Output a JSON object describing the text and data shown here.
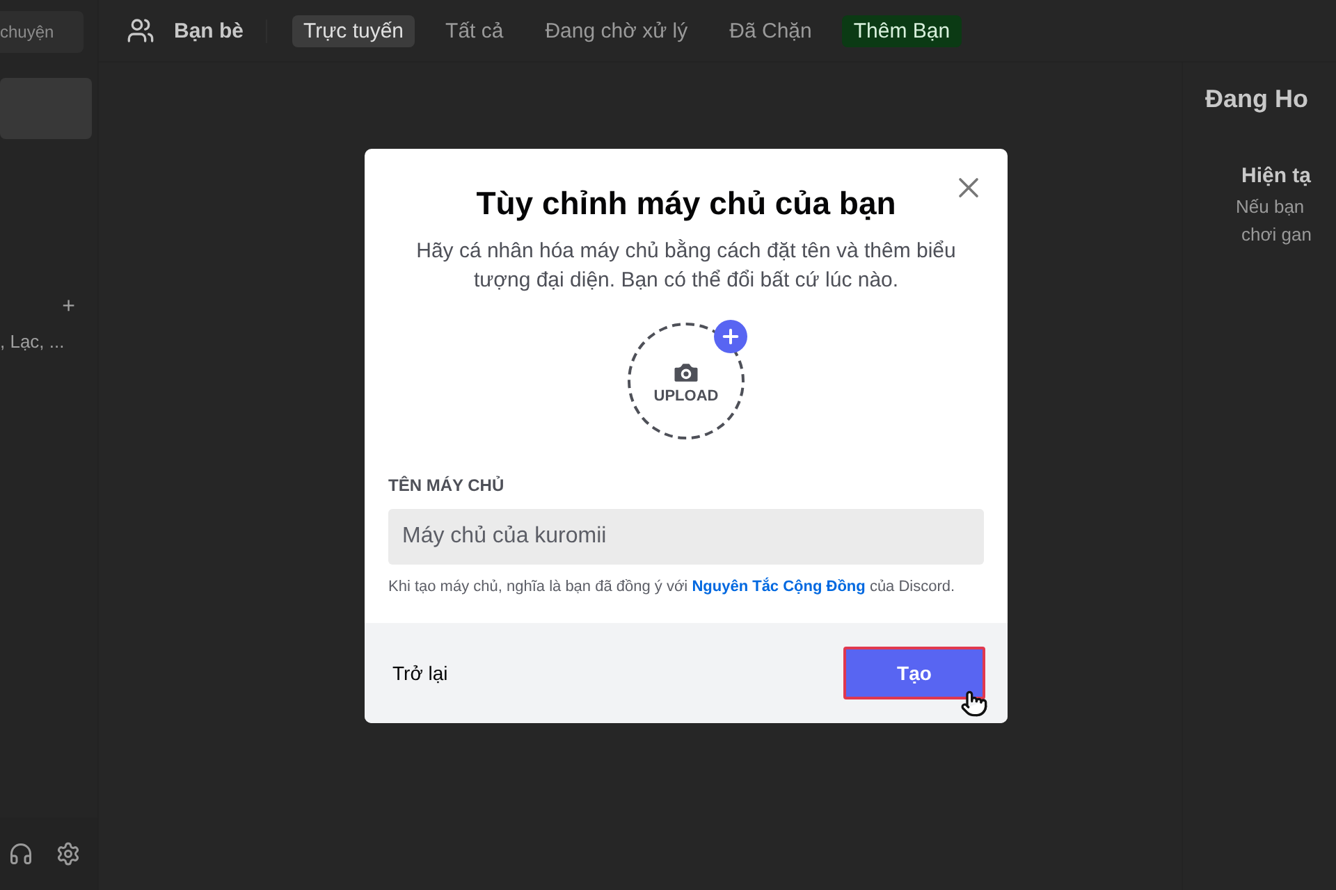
{
  "sidebar": {
    "search_text": "chuyện",
    "section_add": "+",
    "dm_preview": ", Lạc, ..."
  },
  "header": {
    "title": "Bạn bè",
    "tabs": [
      {
        "label": "Trực tuyến",
        "selected": true,
        "kind": "tab"
      },
      {
        "label": "Tất cả",
        "selected": false,
        "kind": "tab"
      },
      {
        "label": "Đang chờ xử lý",
        "selected": false,
        "kind": "tab"
      },
      {
        "label": "Đã Chặn",
        "selected": false,
        "kind": "tab"
      },
      {
        "label": "Thêm Bạn",
        "selected": false,
        "kind": "add"
      }
    ]
  },
  "right_panel": {
    "title": "Đang Ho",
    "subtitle": "Hiện tạ",
    "lines": [
      "Nếu bạn",
      "chơi gan"
    ]
  },
  "dialog": {
    "title": "Tùy chỉnh máy chủ của bạn",
    "description": "Hãy cá nhân hóa máy chủ bằng cách đặt tên và thêm biểu tượng đại diện. Bạn có thể đổi bất cứ lúc nào.",
    "upload_label": "UPLOAD",
    "field_label": "TÊN MÁY CHỦ",
    "field_value": "Máy chủ của kuromii",
    "terms": {
      "before": "Khi tạo máy chủ, nghĩa là bạn đã đồng ý với",
      "link": "Nguyên Tắc Cộng Đồng",
      "after": "của Discord."
    },
    "back_button": "Trở lại",
    "create_button": "Tạo"
  }
}
